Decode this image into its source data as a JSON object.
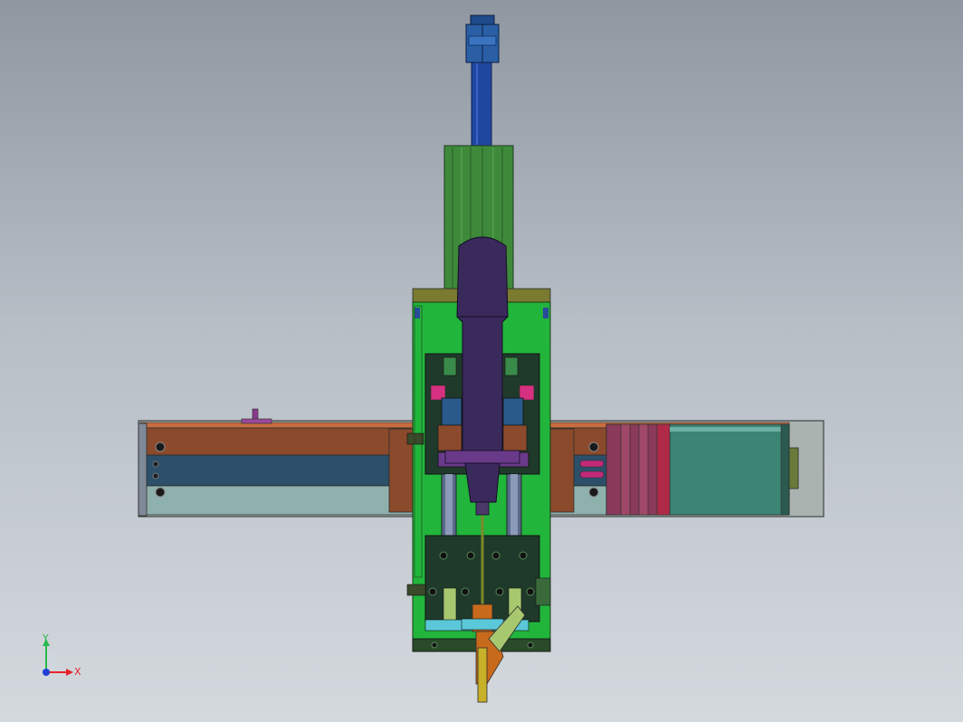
{
  "viewport": {
    "background_top": "#8f97a1",
    "background_bottom": "#d4d9de"
  },
  "triad": {
    "x_label": "X",
    "y_label": "Y",
    "z_label": "",
    "x_color": "#e8222a",
    "y_color": "#29b84a",
    "z_color": "#1f3fd6"
  },
  "model": {
    "parts": [
      "x-axis-linear-module",
      "stepper-motor",
      "vertical-slide-plate",
      "z-axis-cylinder",
      "piston-rod",
      "spindle-motor",
      "clamp-block",
      "tool-holder",
      "angled-nozzle"
    ],
    "part_colors": {
      "rail_copper": "#8c4a2c",
      "rail_blue": "#2c4f6a",
      "rail_grey": "#8fb1ad",
      "motor_teal": "#3c8474",
      "plate_green": "#22b53c",
      "cylinder_green": "#3f8a3a",
      "rod_blue": "#1f47a0",
      "spindle_purple": "#3a2a5c",
      "accent_magenta": "#c02a78",
      "nozzle_orange": "#c86a1c"
    }
  }
}
